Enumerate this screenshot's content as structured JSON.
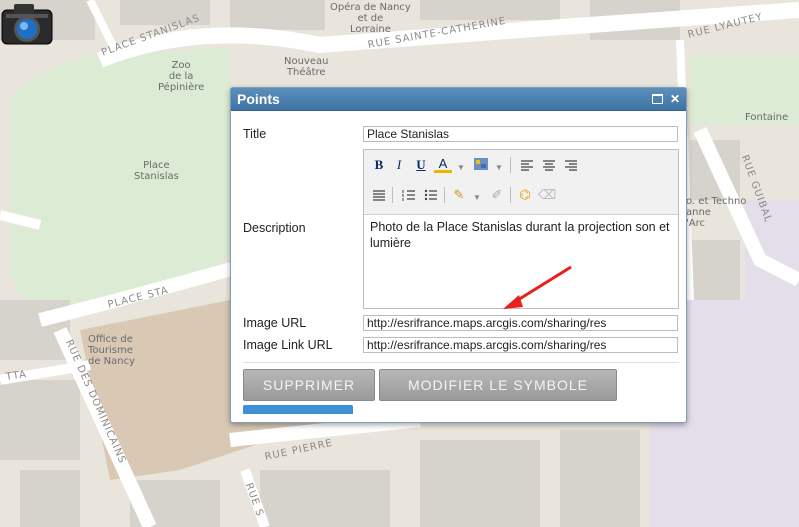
{
  "map": {
    "streets": {
      "place_stanislas_top": "PLACE STANISLAS",
      "rue_sainte_catherine": "RUE SAINTE-CATHERINE",
      "rue_lyautey": "RUE LYAUTEY",
      "rue_guibal": "RUE GUIBAL",
      "place_stanislas_bottom": "PLACE STA",
      "rue_des_dominicains": "RUE DES DOMINICAINS",
      "rue_pierre": "RUE PIERRE",
      "rue_left": "TTA",
      "rue_bottom": "RUE S"
    },
    "places": {
      "opera": "Opéra de Nancy\net de\nLorraine",
      "zoo": "Zoo\nde la\nPépinière",
      "nouveau_theatre": "Nouveau\nThéâtre",
      "place_stanislas": "Place\nStanislas",
      "fontaine": "Fontaine",
      "office_tourisme": "Office de\nTourisme\nde Nancy",
      "techno": "o. et Techno\nanne\n'Arc"
    }
  },
  "popup": {
    "title": "Points",
    "title_label": "Title",
    "title_value": "Place Stanislas",
    "description_label": "Description",
    "description_value": "Photo de la Place Stanislas durant la projection son et lumière",
    "image_url_label": "Image URL",
    "image_url_value": "http://esrifrance.maps.arcgis.com/sharing/res",
    "image_link_url_label": "Image Link URL",
    "image_link_url_value": "http://esrifrance.maps.arcgis.com/sharing/res",
    "delete_button": "SUPPRIMER",
    "edit_symbol_button": "MODIFIER LE SYMBOLE"
  },
  "toolbar": {
    "bold": "B",
    "italic": "I",
    "underline": "U",
    "font_color": "A"
  },
  "colors": {
    "header": "#4a7fb0",
    "accent_arrow": "#e8201c",
    "button_gray": "#a8a8a8",
    "blue_bar": "#3d8fd6"
  }
}
